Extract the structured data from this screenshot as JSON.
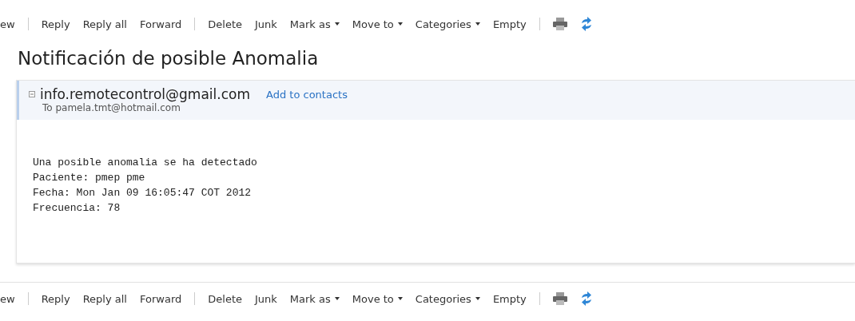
{
  "toolbars": [
    {
      "items": [
        {
          "kind": "button",
          "label": "ew"
        },
        {
          "kind": "divider"
        },
        {
          "kind": "button",
          "label": "Reply"
        },
        {
          "kind": "button",
          "label": "Reply all"
        },
        {
          "kind": "button",
          "label": "Forward"
        },
        {
          "kind": "divider"
        },
        {
          "kind": "button",
          "label": "Delete"
        },
        {
          "kind": "button",
          "label": "Junk"
        },
        {
          "kind": "menu",
          "label": "Mark as"
        },
        {
          "kind": "menu",
          "label": "Move to"
        },
        {
          "kind": "menu",
          "label": "Categories"
        },
        {
          "kind": "button",
          "label": "Empty"
        },
        {
          "kind": "divider"
        },
        {
          "kind": "print"
        },
        {
          "kind": "refresh"
        }
      ]
    }
  ],
  "subject": "Notificación de posible Anomalia",
  "message": {
    "sender": "info.remotecontrol@gmail.com",
    "add_contact": "Add to contacts",
    "to": "To pamela.tmt@hotmail.com",
    "body": [
      "Una posible anomalia se ha detectado",
      "Paciente: pmep pme",
      "Fecha: Mon Jan 09 16:05:47 COT 2012",
      "Frecuencia: 78"
    ]
  },
  "bottom_toolbar": {
    "items": [
      {
        "kind": "button",
        "label": "ew"
      },
      {
        "kind": "divider"
      },
      {
        "kind": "button",
        "label": "Reply"
      },
      {
        "kind": "button",
        "label": "Reply all"
      },
      {
        "kind": "button",
        "label": "Forward"
      },
      {
        "kind": "divider"
      },
      {
        "kind": "button",
        "label": "Delete"
      },
      {
        "kind": "button",
        "label": "Junk"
      },
      {
        "kind": "menu",
        "label": "Mark as"
      },
      {
        "kind": "menu",
        "label": "Move to"
      },
      {
        "kind": "menu",
        "label": "Categories"
      },
      {
        "kind": "button",
        "label": "Empty"
      },
      {
        "kind": "divider"
      },
      {
        "kind": "print"
      },
      {
        "kind": "refresh"
      }
    ]
  }
}
